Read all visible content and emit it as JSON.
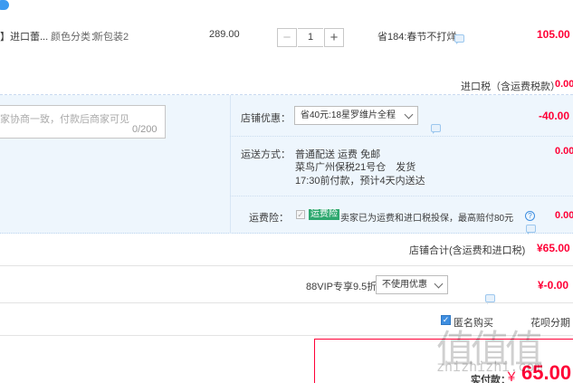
{
  "item": {
    "name": "】进口蕾...",
    "sku_label": "颜色分类：",
    "sku_value": "新包装2",
    "unit_price": "289.00",
    "quantity": "1",
    "minus": "−",
    "plus": "+",
    "promo": "省184:春节不打烊",
    "subtotal": "105.00"
  },
  "import_tax": {
    "label": "进口税（含运费税款）",
    "value": "0.00"
  },
  "message": {
    "placeholder": "家协商一致，付款后商家可见",
    "counter": "0/200"
  },
  "shop_discount": {
    "label": "店铺优惠：",
    "selected": "省40元:18星罗维片全程",
    "value": "-40.00"
  },
  "shipping": {
    "label": "运送方式：",
    "line1": "普通配送 运费 免邮",
    "line2": "菜鸟广州保税21号仓　发货",
    "line3": "17:30前付款，预计4天内送达",
    "value": "0.00"
  },
  "freight_insurance": {
    "label": "运费险：",
    "badge": "运费险",
    "text": "卖家已为运费和进口税投保，最高赔付80元",
    "value": "0.00"
  },
  "shop_total": {
    "label": "店铺合计(含运费和进口税)",
    "value": "¥65.00"
  },
  "vip": {
    "label": "88VIP专享9.5折",
    "selected": "不使用优惠",
    "value": "¥-0.00"
  },
  "options": {
    "anonymous": "匿名购买",
    "installment": "花呗分期"
  },
  "payment": {
    "label": "实付款：",
    "currency": "￥",
    "amount": "65.00"
  },
  "watermark": {
    "big": "值值值",
    "url": "zhizhizhi.com"
  },
  "colors": {
    "red": "#ff0036",
    "blue_band": "#eef6fd",
    "border": "#dddddd"
  }
}
